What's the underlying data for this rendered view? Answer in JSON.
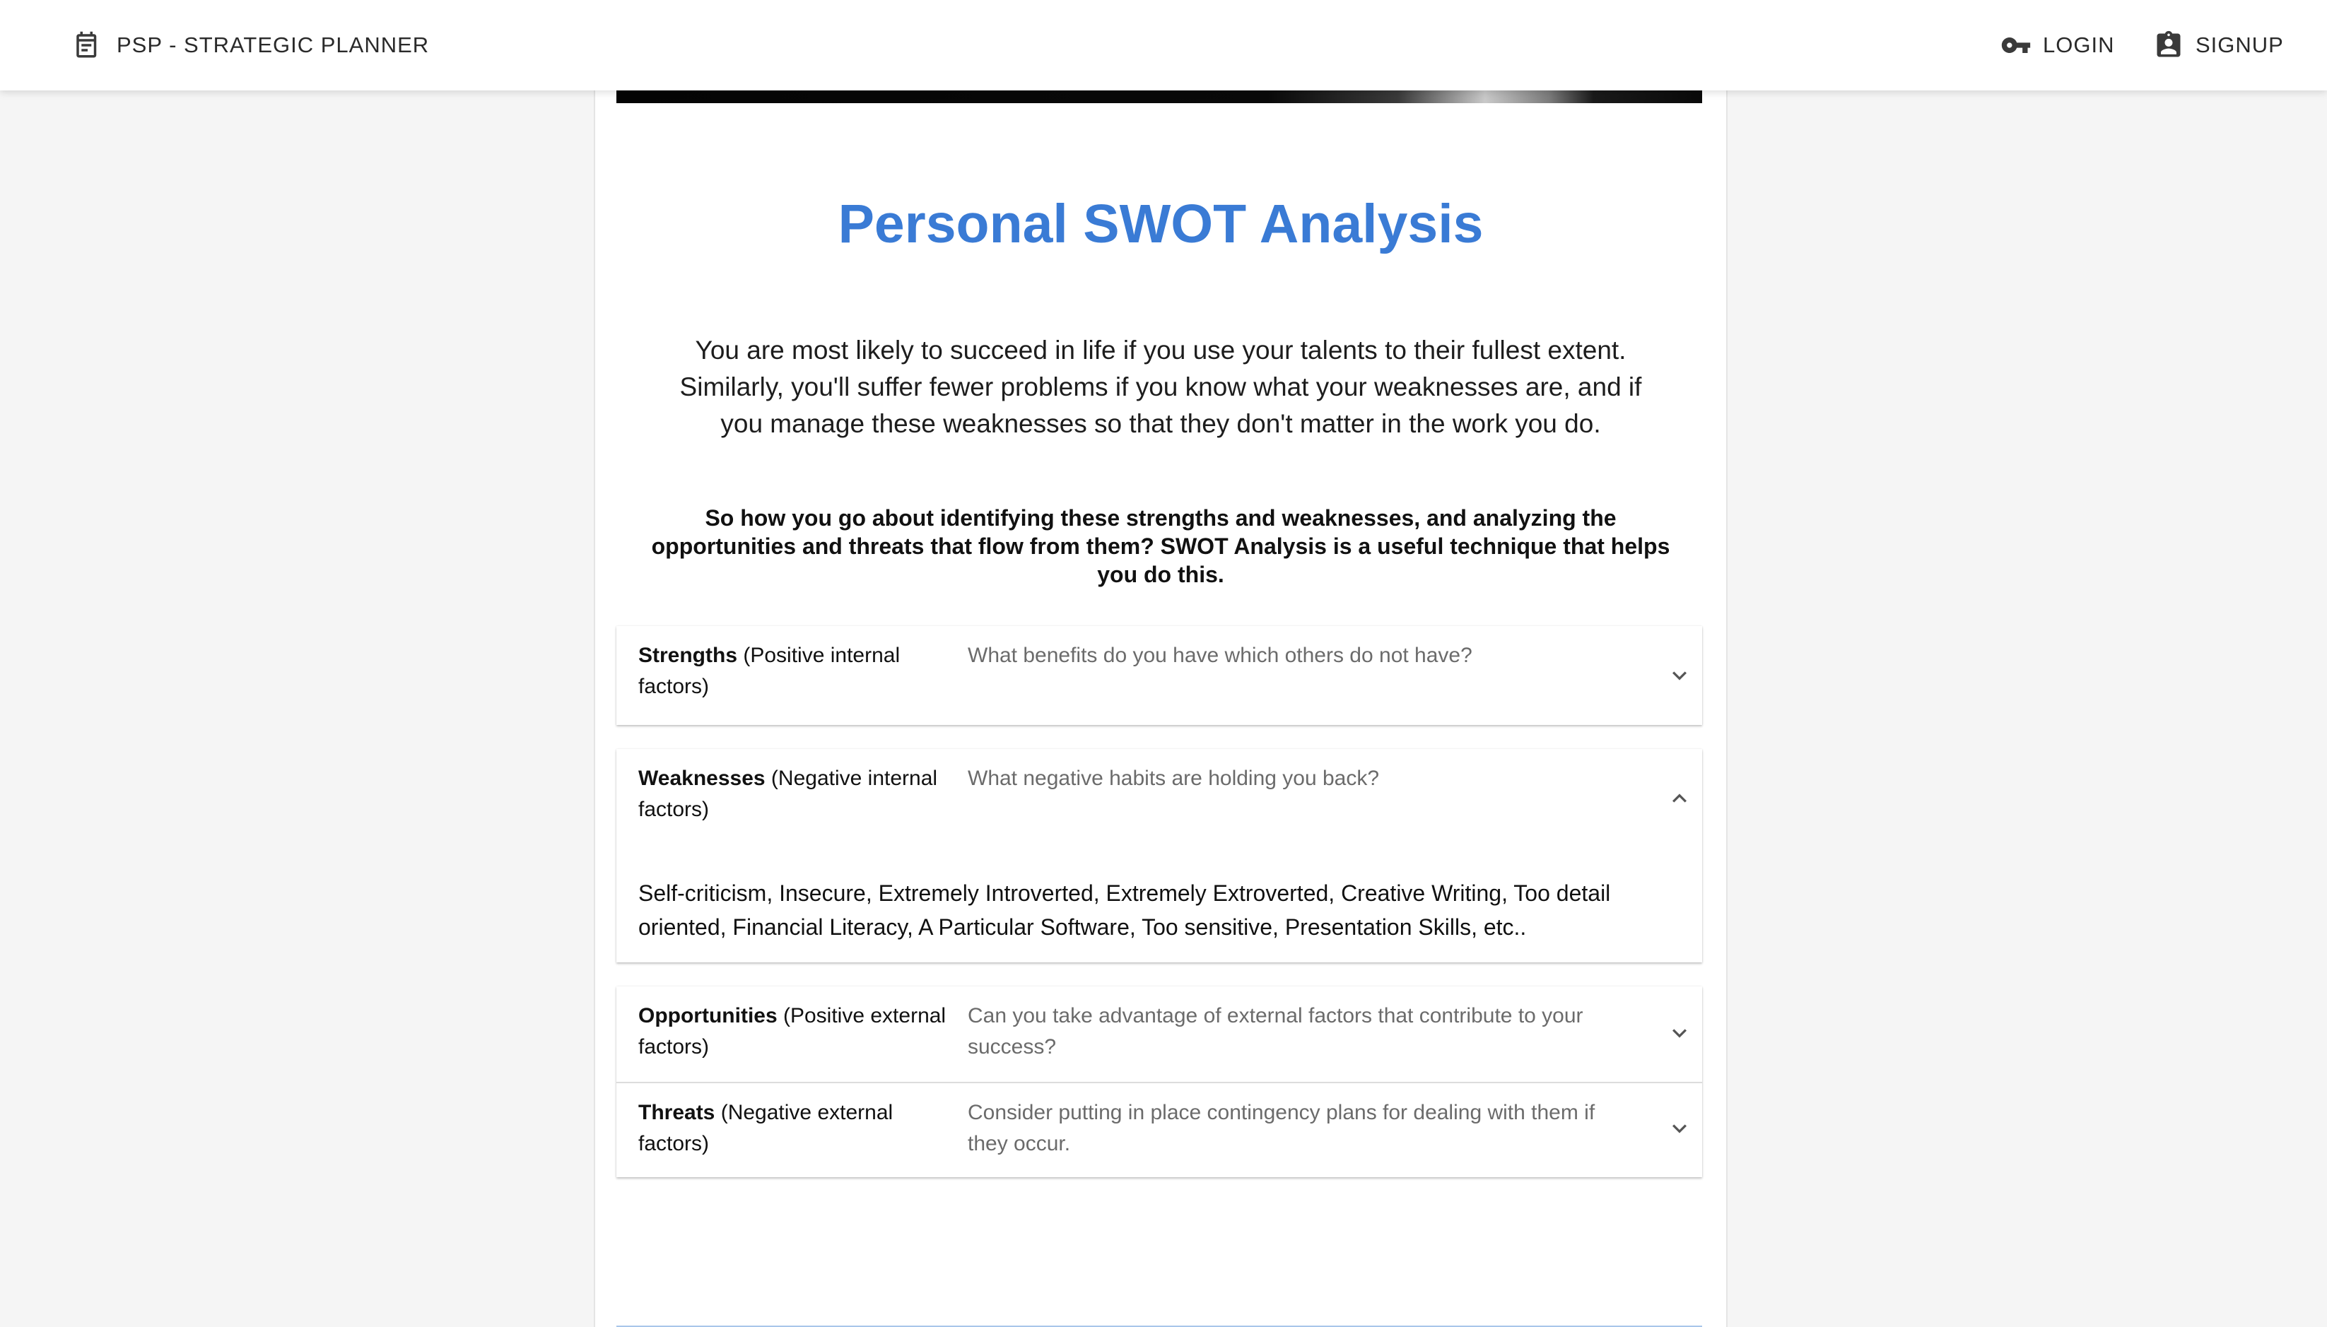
{
  "appbar": {
    "brand": "PSP - STRATEGIC PLANNER",
    "brand_icon": "calendar-icon",
    "login_label": "LOGIN",
    "login_icon": "key-icon",
    "signup_label": "SIGNUP",
    "signup_icon": "contact-badge-icon"
  },
  "page": {
    "title": "Personal SWOT Analysis",
    "intro": "You are most likely to succeed in life if you use your talents to their fullest extent. Similarly, you'll suffer fewer problems if you know what your weaknesses are, and if you manage these weaknesses so that they don't matter in the work you do.",
    "lead": "So how you go about identifying these strengths and weaknesses, and analyzing the opportunities and threats that flow from them? SWOT Analysis is a useful technique that helps you do this.",
    "accent_color": "#3a7bd5"
  },
  "accordion": [
    {
      "name": "Strengths",
      "qualifier": "(Positive internal factors)",
      "question": "What benefits do you have which others do not have?",
      "expanded": false,
      "icon": "chevron-down-icon"
    },
    {
      "name": "Weaknesses",
      "qualifier": "(Negative internal factors)",
      "question": "What negative habits are holding you back?",
      "expanded": true,
      "icon": "chevron-up-icon",
      "details": "Self-criticism, Insecure, Extremely Introverted, Extremely Extroverted, Creative Writing, Too detail oriented, Financial Literacy, A Particular Software, Too sensitive, Presentation Skills, etc.."
    },
    {
      "name": "Opportunities",
      "qualifier": "(Positive external factors)",
      "question": "Can you take advantage of external factors that contribute to your success?",
      "expanded": false,
      "icon": "chevron-down-icon"
    },
    {
      "name": "Threats",
      "qualifier": "(Negative external factors)",
      "question": "Consider putting in place contingency plans for dealing with them if they occur.",
      "expanded": false,
      "icon": "chevron-down-icon"
    }
  ]
}
